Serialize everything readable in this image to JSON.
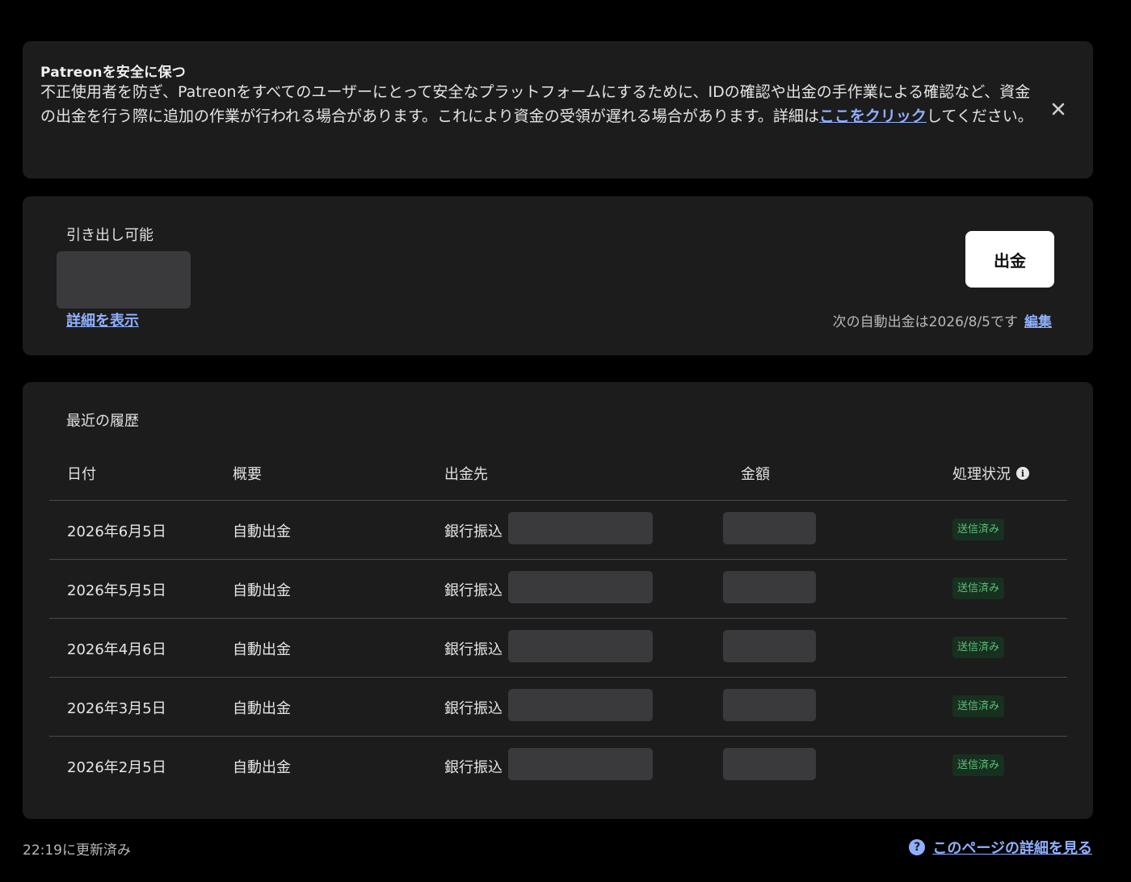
{
  "notice": {
    "title": "Patreonを安全に保つ",
    "body_before": "不正使用者を防ぎ、Patreonをすべてのユーザーにとって安全なプラットフォームにするために、IDの確認や出金の手作業による確認など、資金の出金を行う際に追加の作業が行われる場合があります。これにより資金の受領が遅れる場合があります。詳細は",
    "link_text": "ここをクリック",
    "body_after": "してください。"
  },
  "balance": {
    "label": "引き出し可能",
    "details_link": "詳細を表示",
    "withdraw_button": "出金",
    "next_auto_payout": "次の自動出金は2026/8/5です",
    "edit_link": "編集"
  },
  "history": {
    "title": "最近の履歴",
    "columns": [
      "日付",
      "概要",
      "出金先",
      "金額",
      "処理状況"
    ],
    "rows": [
      {
        "date": "2026年6月5日",
        "summary": "自動出金",
        "destination": "銀行振込",
        "status": "送信済み"
      },
      {
        "date": "2026年5月5日",
        "summary": "自動出金",
        "destination": "銀行振込",
        "status": "送信済み"
      },
      {
        "date": "2026年4月6日",
        "summary": "自動出金",
        "destination": "銀行振込",
        "status": "送信済み"
      },
      {
        "date": "2026年3月5日",
        "summary": "自動出金",
        "destination": "銀行振込",
        "status": "送信済み"
      },
      {
        "date": "2026年2月5日",
        "summary": "自動出金",
        "destination": "銀行振込",
        "status": "送信済み"
      }
    ]
  },
  "footer": {
    "updated": "22:19に更新済み",
    "help_link": "このページの詳細を見る"
  },
  "icons": {
    "close": "close-icon",
    "info": "info-icon",
    "help": "question-circle-icon"
  },
  "colors": {
    "accent_link": "#8fb0ff",
    "status_text": "#5fbf7a",
    "status_bg": "#17301f"
  }
}
